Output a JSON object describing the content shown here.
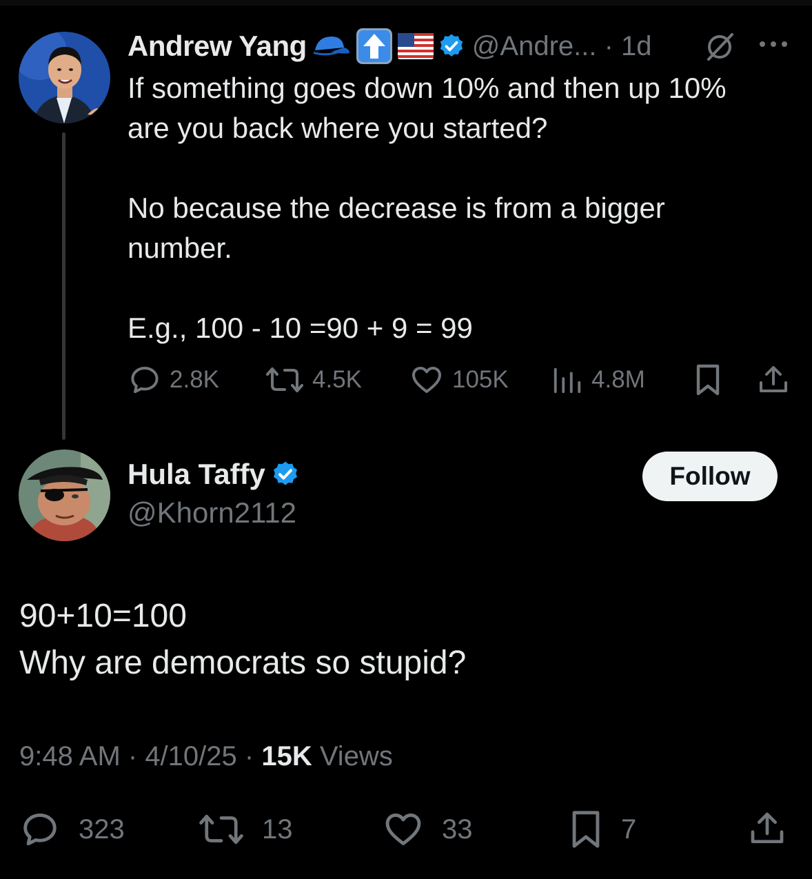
{
  "tweet": {
    "author_name": "Andrew Yang",
    "handle_meta": "@Andre... · 1d",
    "lines": [
      "If something goes down 10% and then up 10%",
      "are you back where you started?",
      "",
      "No because the decrease is from a bigger",
      "number.",
      "",
      "E.g., 100 - 10 =90 + 9 = 99"
    ],
    "stats": {
      "replies": "2.8K",
      "reposts": "4.5K",
      "likes": "105K",
      "views": "4.8M"
    }
  },
  "reply": {
    "author_name": "Hula Taffy",
    "handle": "@Khorn2112",
    "follow_label": "Follow",
    "lines": [
      "90+10=100",
      "Why are democrats so stupid?"
    ],
    "time": "9:48 AM",
    "date": "4/10/25",
    "views_count": "15K",
    "views_label": "Views",
    "stats": {
      "replies": "323",
      "reposts": "13",
      "likes": "33",
      "bookmarks": "7"
    }
  },
  "colors": {
    "background": "#000000",
    "text": "#e7e9ea",
    "muted": "#71767b",
    "verified": "#1d9bf0",
    "thread_line": "#333639"
  },
  "icons": [
    "cap-emoji-icon",
    "up-arrow-emoji-icon",
    "us-flag-emoji-icon",
    "verified-badge-icon",
    "grok-icon",
    "more-icon",
    "reply-icon",
    "repost-icon",
    "like-icon",
    "views-icon",
    "bookmark-icon",
    "share-icon"
  ]
}
